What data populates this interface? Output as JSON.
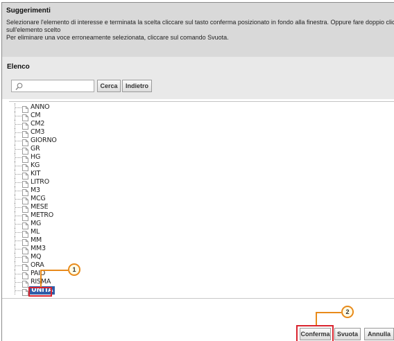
{
  "hints": {
    "title": "Suggerimenti",
    "line1": "Selezionare l'elemento di interesse e terminata la scelta cliccare sul tasto conferma posizionato in fondo alla finestra. Oppure fare doppio click",
    "line2": "sull'elemento scelto",
    "line3": "Per eliminare una voce erroneamente selezionata, cliccare sul comando Svuota."
  },
  "elenco": {
    "title": "Elenco",
    "search_value": "",
    "cerca_label": "Cerca",
    "indietro_label": "Indietro"
  },
  "tree": {
    "items": [
      "ANNO",
      "CM",
      "CM2",
      "CM3",
      "GIORNO",
      "GR",
      "HG",
      "KG",
      "KIT",
      "LITRO",
      "M3",
      "MCG",
      "MESE",
      "METRO",
      "MG",
      "ML",
      "MM",
      "MM3",
      "MQ",
      "ORA",
      "PAIO",
      "RISMA",
      "UNITA"
    ],
    "selected": "UNITA"
  },
  "footer": {
    "conferma_label": "Conferma",
    "svuota_label": "Svuota",
    "annulla_label": "Annulla"
  },
  "callouts": {
    "badge1": "1",
    "badge2": "2"
  },
  "colors": {
    "highlight": "#d9232e",
    "callout": "#e88a1a",
    "selection": "#2f5da8"
  }
}
